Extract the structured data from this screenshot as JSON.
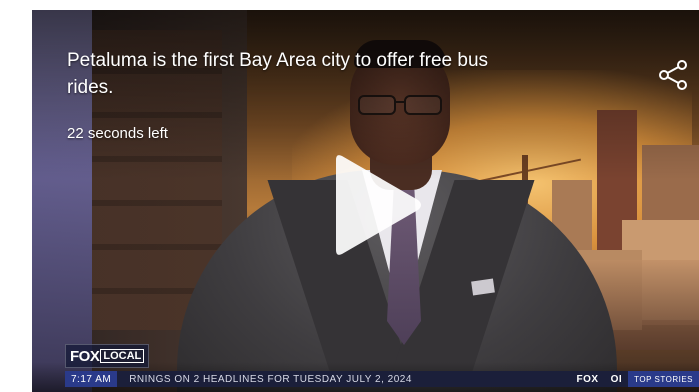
{
  "video": {
    "title": "Petaluma is the first Bay Area city to offer free bus rides.",
    "time_left": "22 seconds left"
  },
  "lower_third": {
    "logo_fox": "FOX",
    "logo_local": "LOCAL",
    "ticker_time": "7:17 AM",
    "ticker_text": "RNINGS ON 2 HEADLINES FOR TUESDAY JULY 2, 2024",
    "ticker_fox": "FOX",
    "ticker_extra": "OI",
    "ticker_top": "TOP STORIES"
  },
  "icons": {
    "share": "share-icon",
    "play": "play-icon"
  },
  "colors": {
    "overlay_text": "#ffffff",
    "play_button": "#ffffff",
    "ticker_bg": "#1b1f3a",
    "ticker_accent": "#2a3a8a"
  }
}
